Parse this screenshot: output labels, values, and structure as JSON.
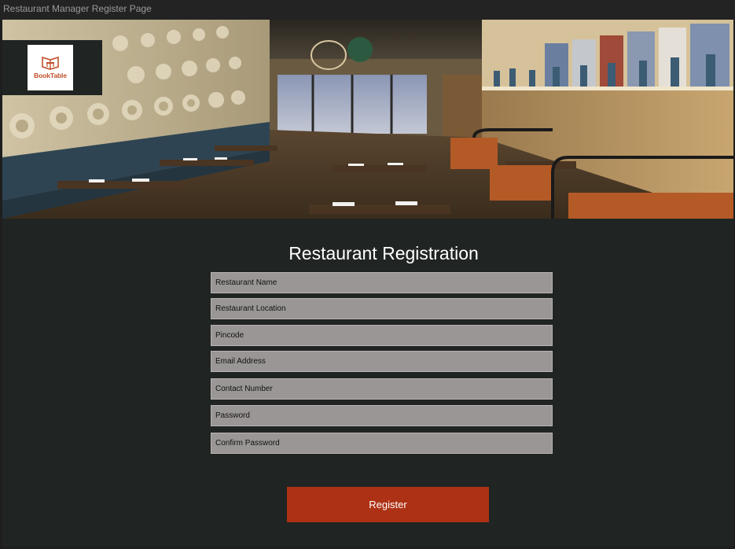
{
  "window": {
    "title": "Restaurant Manager Register Page"
  },
  "brand": {
    "name": "BookTable",
    "color": "#c0502a"
  },
  "hero": {
    "image": "restaurant-interior"
  },
  "form": {
    "title": "Restaurant Registration",
    "fields": [
      {
        "name": "restaurant-name-field",
        "placeholder": "Restaurant Name"
      },
      {
        "name": "restaurant-location-field",
        "placeholder": "Restaurant Location"
      },
      {
        "name": "pincode-field",
        "placeholder": " Pincode"
      },
      {
        "name": "email-field",
        "placeholder": "Email Address"
      },
      {
        "name": "contact-number-field",
        "placeholder": "Contact Number"
      },
      {
        "name": "password-field",
        "placeholder": " Password"
      },
      {
        "name": "confirm-password-field",
        "placeholder": "Confirm Password"
      }
    ],
    "submit_label": "Register"
  },
  "colors": {
    "background": "#202422",
    "field_bg": "#9a9696",
    "button": "#ad3115"
  }
}
